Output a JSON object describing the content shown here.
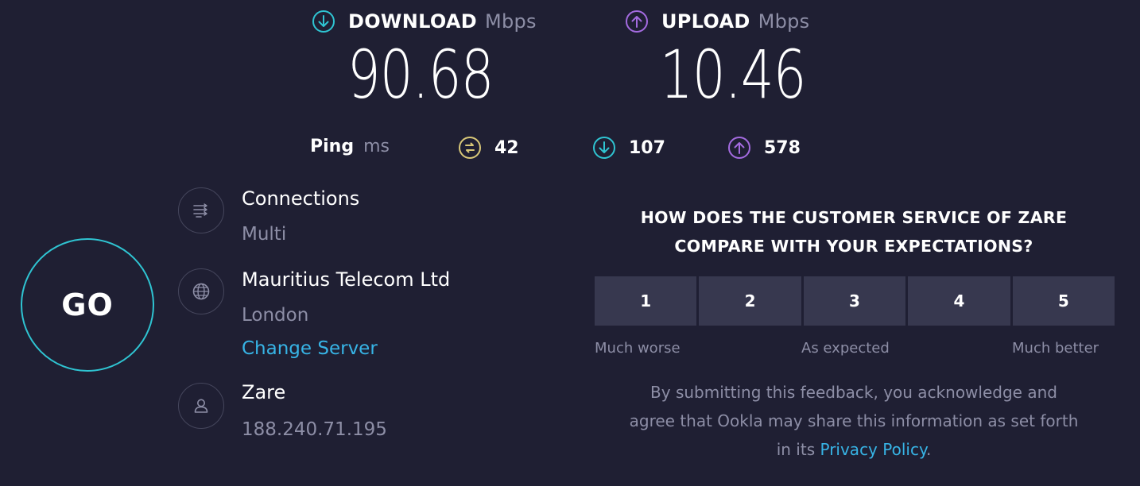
{
  "download": {
    "label": "DOWNLOAD",
    "unit": "Mbps",
    "value": "90.68",
    "icon": "download-circle-icon",
    "color": "#2fc4d2"
  },
  "upload": {
    "label": "UPLOAD",
    "unit": "Mbps",
    "value": "10.46",
    "icon": "upload-circle-icon",
    "color": "#a46be0"
  },
  "ping": {
    "label": "Ping",
    "unit": "ms",
    "idle": {
      "value": "42",
      "icon": "ping-idle-icon",
      "color": "#d9c878"
    },
    "download": {
      "value": "107",
      "icon": "download-circle-icon",
      "color": "#2fc4d2"
    },
    "upload": {
      "value": "578",
      "icon": "upload-circle-icon",
      "color": "#a46be0"
    }
  },
  "go_button": {
    "label": "GO",
    "color": "#2fc4d2"
  },
  "connections": {
    "title": "Connections",
    "value": "Multi",
    "icon": "connections-icon"
  },
  "server": {
    "title": "Mauritius Telecom Ltd",
    "location": "London",
    "change_label": "Change Server",
    "icon": "globe-icon"
  },
  "provider": {
    "title": "Zare",
    "ip": "188.240.71.195",
    "icon": "user-icon"
  },
  "survey": {
    "question_line1": "HOW DOES THE CUSTOMER SERVICE OF ZARE",
    "question_line2": "COMPARE WITH YOUR EXPECTATIONS?",
    "ratings": [
      "1",
      "2",
      "3",
      "4",
      "5"
    ],
    "scale_low": "Much worse",
    "scale_mid": "As expected",
    "scale_high": "Much better",
    "disclaimer_line1": "By submitting this feedback, you acknowledge and",
    "disclaimer_line2": "agree that Ookla may share this information as set forth",
    "disclaimer_line3_prefix": "in its",
    "privacy_link": "Privacy Policy",
    "disclaimer_line3_suffix": "."
  }
}
